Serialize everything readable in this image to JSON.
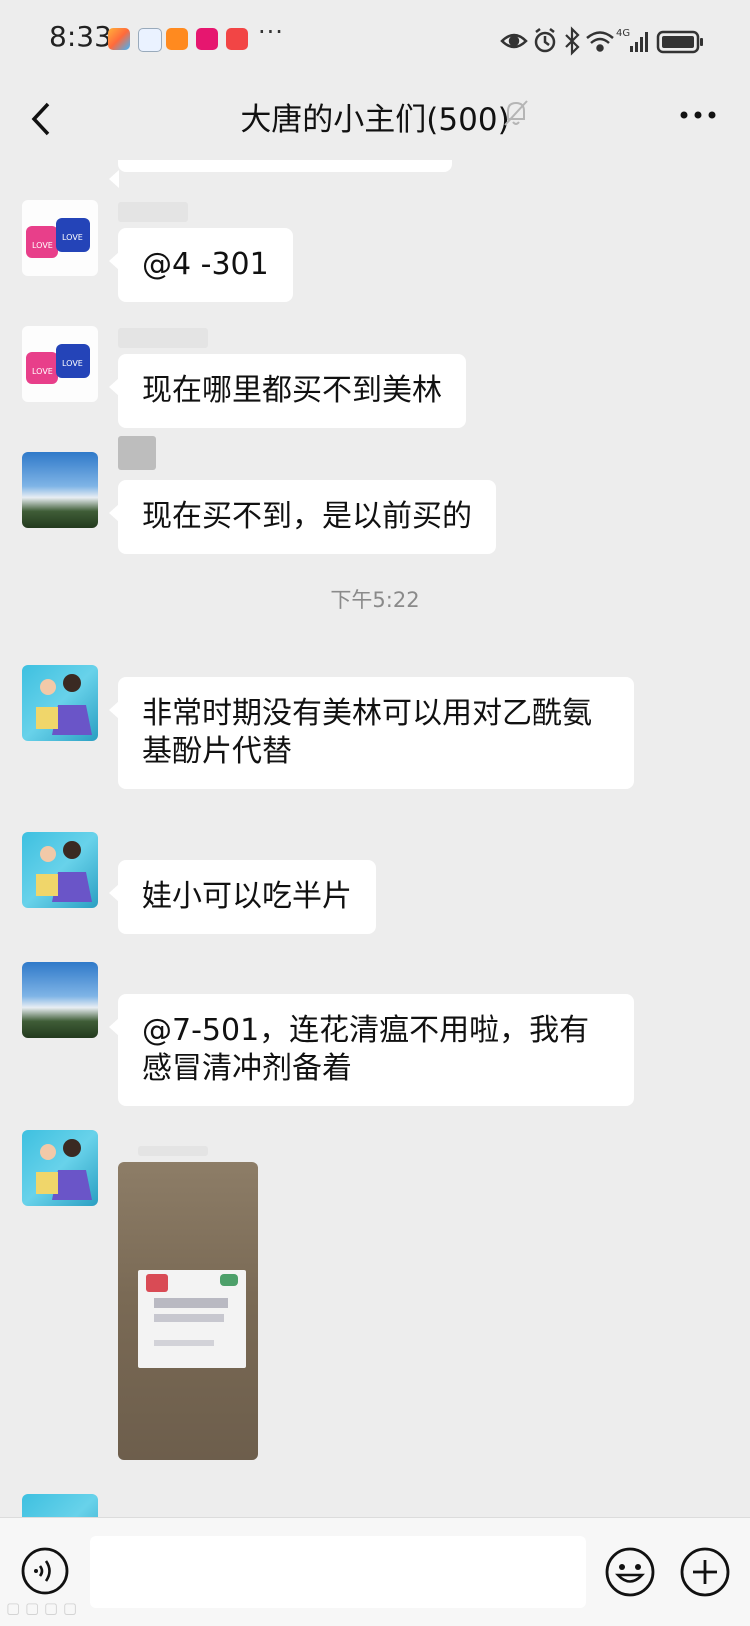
{
  "status_bar": {
    "time": "8:33",
    "overflow": "···",
    "network": "4G",
    "icons": [
      "eye-icon",
      "alarm-icon",
      "bluetooth-icon",
      "wifi-icon",
      "signal-icon",
      "battery-icon"
    ]
  },
  "header": {
    "back_icon": "chevron-left-icon",
    "title": "大唐的小主们(500)",
    "mute_icon": "bell-off-icon",
    "more_icon": "more-dots-icon"
  },
  "messages": [
    {
      "avatar": "dice-avatar",
      "text": "@4 -301"
    },
    {
      "avatar": "dice-avatar",
      "text": "现在哪里都买不到美林"
    },
    {
      "avatar": "sky-avatar",
      "text": "现在买不到，是以前买的"
    },
    {
      "type": "time",
      "text": "下午5:22"
    },
    {
      "avatar": "kids-avatar",
      "text": "非常时期没有美林可以用对乙酰氨\n基酚片代替"
    },
    {
      "avatar": "kids-avatar",
      "text": "娃小可以吃半片"
    },
    {
      "avatar": "sky-avatar",
      "text": "@7-501，连花清瘟不用啦，我有\n感冒清冲剂备着"
    },
    {
      "avatar": "kids-avatar",
      "type": "image"
    }
  ],
  "input_bar": {
    "voice_icon": "voice-icon",
    "value": "",
    "emoji_icon": "emoji-icon",
    "plus_icon": "plus-icon"
  },
  "colors": {
    "background": "#ededed",
    "bubble": "#ffffff",
    "input_bar": "#f7f7f7",
    "time_text": "#8a8a8a"
  }
}
